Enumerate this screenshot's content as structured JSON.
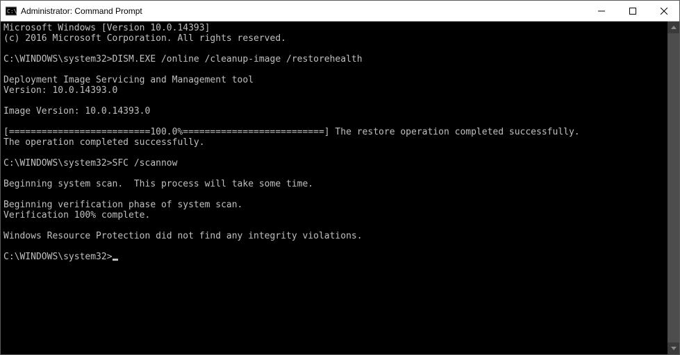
{
  "window": {
    "title": "Administrator: Command Prompt"
  },
  "terminal": {
    "lines": [
      "Microsoft Windows [Version 10.0.14393]",
      "(c) 2016 Microsoft Corporation. All rights reserved.",
      "",
      "C:\\WINDOWS\\system32>DISM.EXE /online /cleanup-image /restorehealth",
      "",
      "Deployment Image Servicing and Management tool",
      "Version: 10.0.14393.0",
      "",
      "Image Version: 10.0.14393.0",
      "",
      "[==========================100.0%==========================] The restore operation completed successfully.",
      "The operation completed successfully.",
      "",
      "C:\\WINDOWS\\system32>SFC /scannow",
      "",
      "Beginning system scan.  This process will take some time.",
      "",
      "Beginning verification phase of system scan.",
      "Verification 100% complete.",
      "",
      "Windows Resource Protection did not find any integrity violations.",
      "",
      "C:\\WINDOWS\\system32>"
    ],
    "prompt_has_cursor": true
  }
}
